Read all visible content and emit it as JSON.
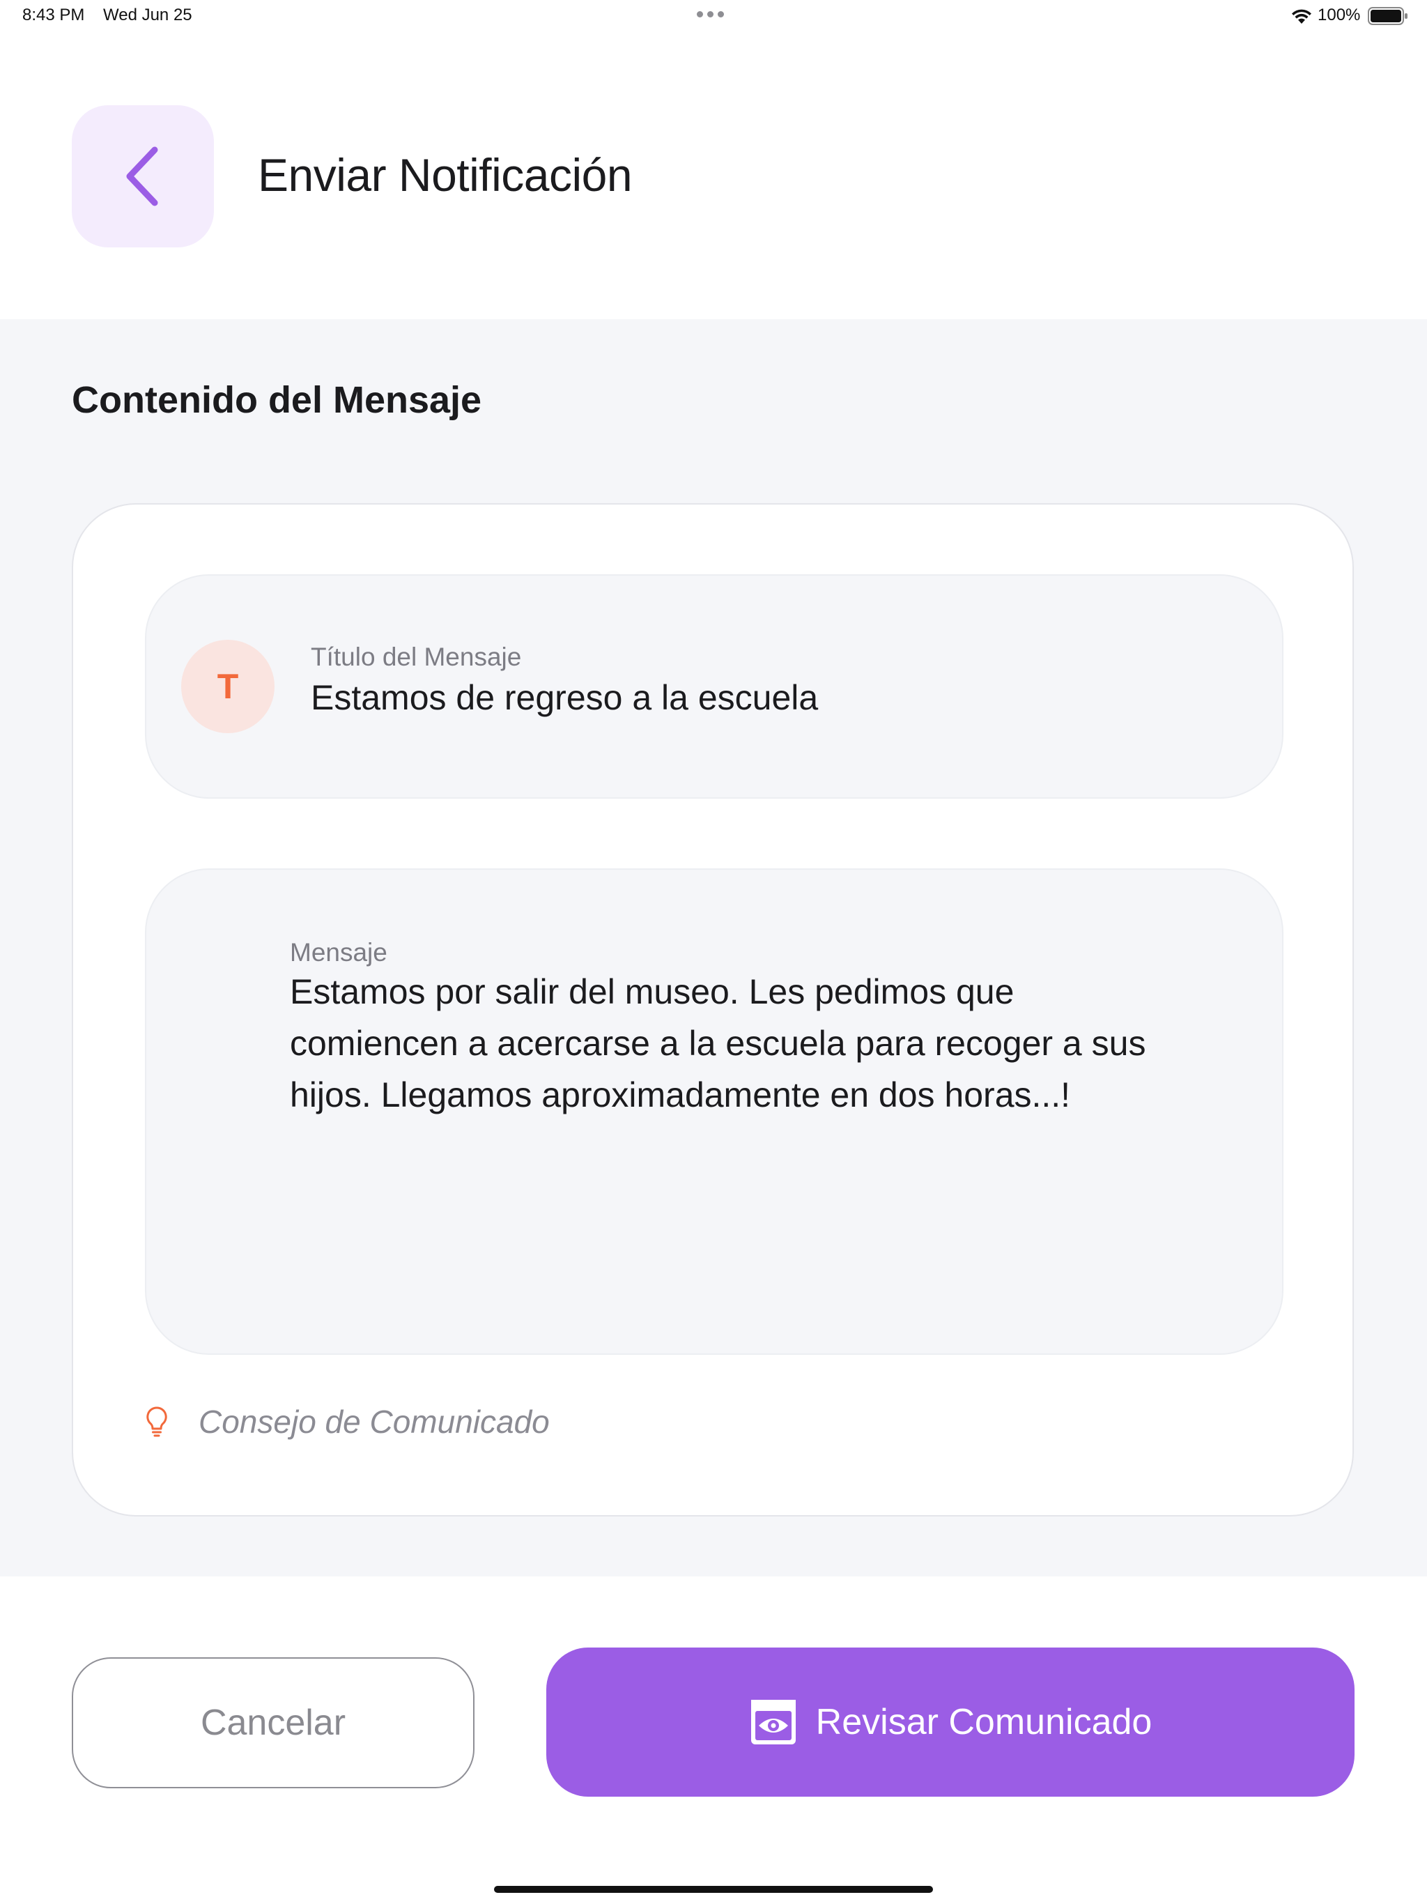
{
  "status_bar": {
    "time": "8:43 PM",
    "date": "Wed Jun 25",
    "battery": "100%"
  },
  "header": {
    "title": "Enviar Notificación",
    "back_icon": "chevron-left-icon",
    "accent": "#9b5de5"
  },
  "section": {
    "title": "Contenido del Mensaje"
  },
  "title_field": {
    "avatar_letter": "T",
    "label": "Título del Mensaje",
    "value": "Estamos de regreso a la escuela"
  },
  "message_field": {
    "label": "Mensaje",
    "lines": [
      "Estamos por salir del museo. Les pedimos que",
      "comiencen a acercarse a la escuela para recoger a sus",
      "hijos. Llegamos aproximadamente en dos horas...!"
    ]
  },
  "tip": {
    "icon": "lightbulb-icon",
    "label": "Consejo de Comunicado"
  },
  "footer": {
    "cancel_label": "Cancelar",
    "review_label": "Revisar Comunicado",
    "review_icon": "eye-preview-icon"
  },
  "colors": {
    "primary": "#9b5de5",
    "avatar_text": "#f2693b",
    "avatar_bg": "#fae4e0",
    "surface": "#f5f6f9"
  }
}
